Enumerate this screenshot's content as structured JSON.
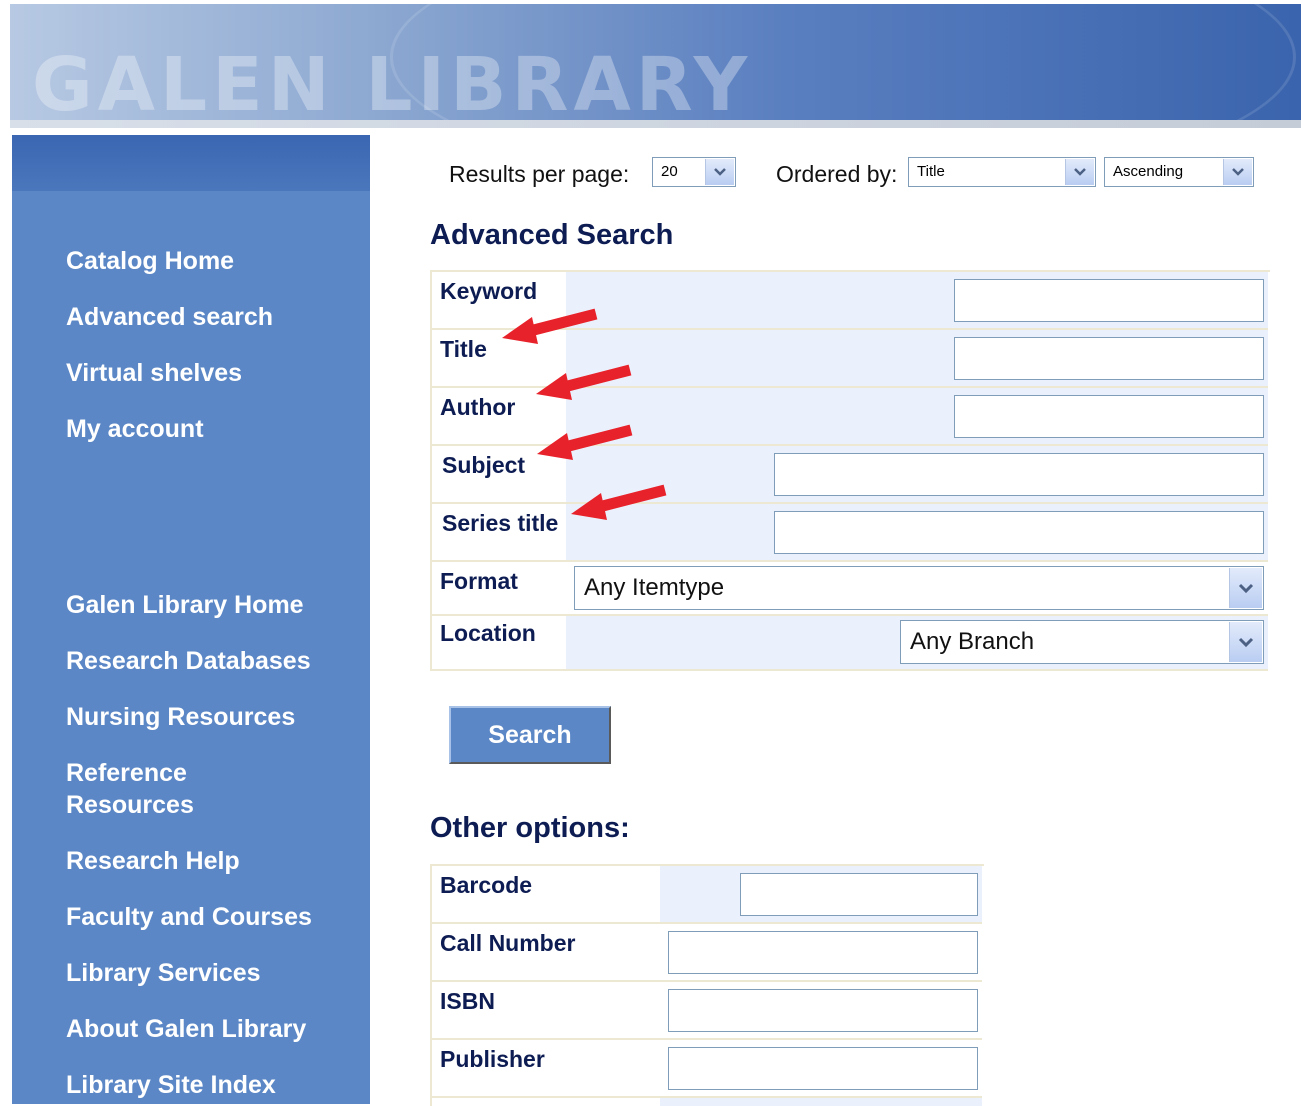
{
  "banner": {
    "title": "GALEN LIBRARY"
  },
  "sidebar": {
    "primary": [
      {
        "label": "Catalog Home"
      },
      {
        "label": "Advanced search"
      },
      {
        "label": "Virtual shelves"
      },
      {
        "label": "My account"
      }
    ],
    "secondary": [
      {
        "label": "Galen Library Home"
      },
      {
        "label": "Research Databases"
      },
      {
        "label": "Nursing Resources"
      },
      {
        "label": "Reference Resources"
      },
      {
        "label": "Research Help"
      },
      {
        "label": "Faculty and Courses"
      },
      {
        "label": "Library Services"
      },
      {
        "label": "About Galen Library"
      },
      {
        "label": "Library Site Index"
      }
    ]
  },
  "toolbar": {
    "results_label": "Results per page:",
    "results_value": "20",
    "ordered_label": "Ordered by:",
    "order_field": "Title",
    "order_direction": "Ascending"
  },
  "advanced": {
    "heading": "Advanced Search",
    "fields": {
      "keyword": "Keyword",
      "title": "Title",
      "author": "Author",
      "subject": "Subject",
      "series": "Series title",
      "format": "Format",
      "location": "Location"
    },
    "format_value": "Any Itemtype",
    "location_value": "Any Branch",
    "search_label": "Search"
  },
  "other": {
    "heading": "Other options:",
    "fields": {
      "barcode": "Barcode",
      "call_number": "Call Number",
      "isbn": "ISBN",
      "publisher": "Publisher"
    }
  },
  "colors": {
    "sidebar": "#5b87c6",
    "label_text": "#0d1c52",
    "arrow": "#e8222a"
  },
  "icons": [
    "chevron-down-icon",
    "red-arrow-annotation"
  ]
}
